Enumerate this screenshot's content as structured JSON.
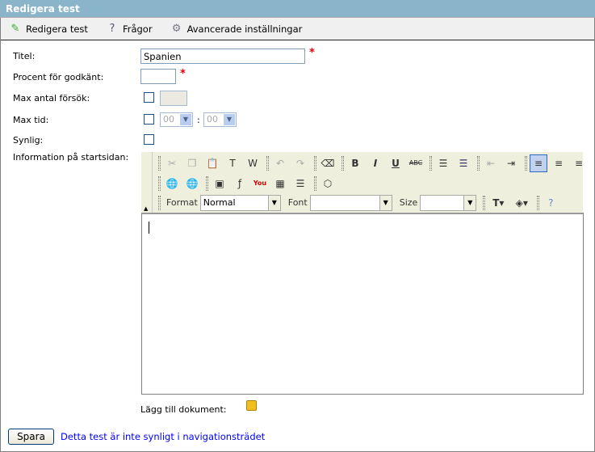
{
  "header": {
    "title": "Redigera test"
  },
  "toolbar": [
    {
      "label": "Redigera test",
      "icon": "edit-check-icon"
    },
    {
      "label": "Frågor",
      "icon": "questions-icon"
    },
    {
      "label": "Avancerade inställningar",
      "icon": "gear-icon"
    }
  ],
  "form": {
    "title_label": "Titel:",
    "title_value": "Spanien",
    "percent_label": "Procent för godkänt:",
    "percent_value": "",
    "required_mark": "*",
    "attempts_label": "Max antal försök:",
    "maxtime_label": "Max tid:",
    "hours": "00",
    "minutes": "00",
    "time_sep": ":",
    "visible_label": "Synlig:",
    "info_label": "Information på startsidan:",
    "docs_label": "Lägg till dokument:"
  },
  "editor": {
    "format_label": "Format",
    "format_value": "Normal",
    "font_label": "Font",
    "font_value": "",
    "size_label": "Size",
    "size_value": "",
    "content": ""
  },
  "footer": {
    "save_label": "Spara",
    "link_text": "Detta test är inte synligt i navigationsträdet"
  },
  "colors": {
    "header_bg": "#8ab4ca",
    "editor_toolbar_bg": "#efefde",
    "required": "#ee0000",
    "link": "#0000ff"
  }
}
